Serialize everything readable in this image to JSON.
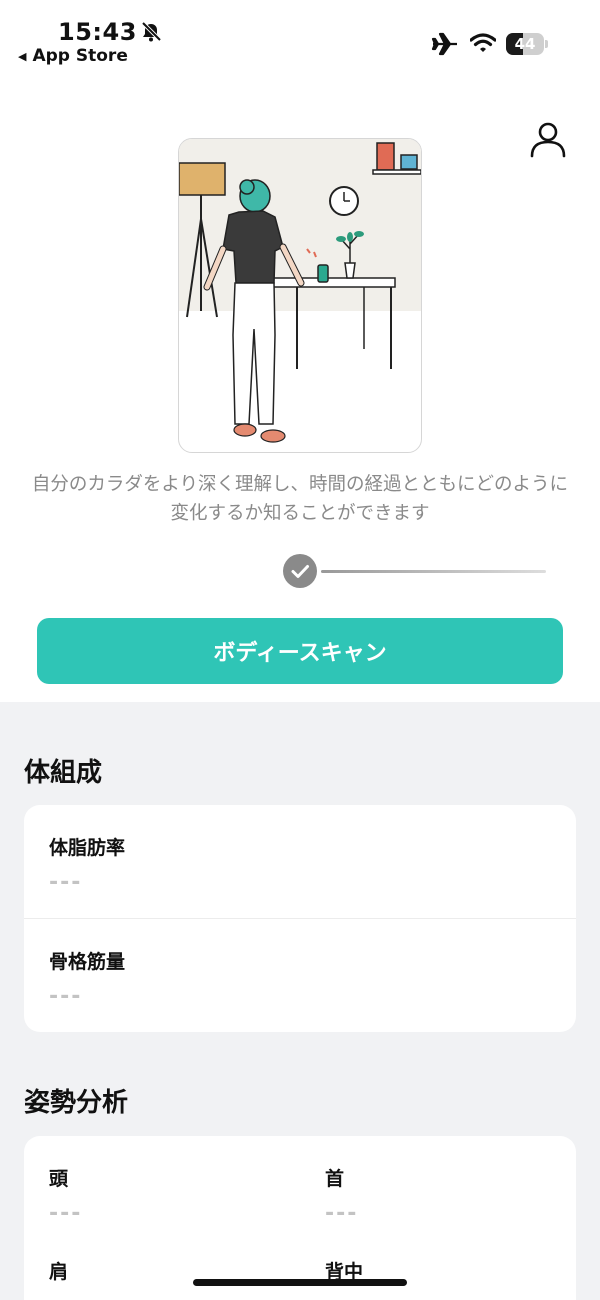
{
  "status_bar": {
    "time": "15:43",
    "back_app": "App Store",
    "battery_level": "44",
    "icons": [
      "bell-slash-icon",
      "airplane-icon",
      "wifi-icon",
      "battery-icon"
    ]
  },
  "header": {
    "profile_icon": "person-icon"
  },
  "onboarding": {
    "description": "自分のカラダをより深く理解し、時間の経過とともにどのように変化するか知ることができます",
    "progress_icon": "check-icon",
    "scan_button": "ボディースキャン"
  },
  "body_composition": {
    "title": "体組成",
    "metrics": [
      {
        "label": "体脂肪率",
        "value": "---"
      },
      {
        "label": "骨格筋量",
        "value": "---"
      }
    ]
  },
  "posture_analysis": {
    "title": "姿勢分析",
    "metrics": [
      {
        "label": "頭",
        "value": "---"
      },
      {
        "label": "首",
        "value": "---"
      },
      {
        "label": "肩",
        "value": ""
      },
      {
        "label": "背中",
        "value": ""
      }
    ]
  },
  "colors": {
    "accent": "#2fc5b6",
    "background_gray": "#f1f2f4",
    "muted_text": "#8a8a8a",
    "placeholder": "#c3c3c3"
  }
}
